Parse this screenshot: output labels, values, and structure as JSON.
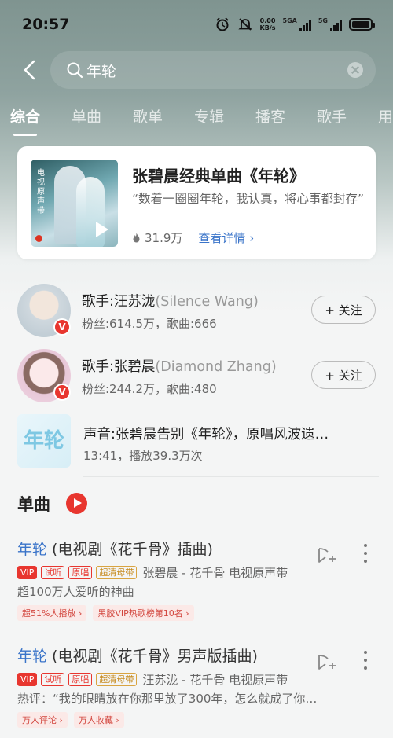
{
  "status_bar": {
    "time": "20:57",
    "net_speed_value": "0.00",
    "net_speed_unit": "KB/s",
    "signal1_label": "5GA",
    "signal2_label": "5G"
  },
  "search": {
    "query": "年轮"
  },
  "tabs": [
    "综合",
    "单曲",
    "歌单",
    "专辑",
    "播客",
    "歌手",
    "用"
  ],
  "feature_card": {
    "cover_text": "电视原声带",
    "title": "张碧晨经典单曲《年轮》",
    "description": "“数着一圈圈年轮，我认真，将心事都封存”",
    "plays": "31.9万",
    "detail_link": "查看详情"
  },
  "artists": [
    {
      "name": "歌手:汪苏泷",
      "alt_name": "(Silence Wang)",
      "meta": "粉丝:614.5万，歌曲:666",
      "follow_label": "+ 关注",
      "badge": "V"
    },
    {
      "name": "歌手:张碧晨",
      "alt_name": "(Diamond Zhang)",
      "meta": "粉丝:244.2万，歌曲:480",
      "follow_label": "+ 关注",
      "badge": "V"
    }
  ],
  "voice": {
    "thumb_text": "年轮",
    "title": "声音:张碧晨告别《年轮》，原唱风波遗…",
    "meta": "13:41，播放39.3万次"
  },
  "singles_section": {
    "title": "单曲"
  },
  "songs": [
    {
      "title_highlight": "年轮",
      "title_rest": " (电视剧《花千骨》插曲)",
      "tags": [
        "VIP",
        "试听",
        "原唱",
        "超清母带"
      ],
      "artist_line": "张碧晨 - 花千骨 电视原声带",
      "desc": "超100万人爱听的神曲",
      "chips": [
        "超51%人播放 ›",
        "黑胶VIP热歌榜第10名 ›"
      ]
    },
    {
      "title_highlight": "年轮",
      "title_rest": " (电视剧《花千骨》男声版插曲)",
      "tags": [
        "VIP",
        "试听",
        "原唱",
        "超清母带"
      ],
      "artist_line": "汪苏泷 - 花千骨 电视原声带",
      "desc": "热评：“我的眼睛放在你那里放了300年，怎么就成了你…",
      "chips": [
        "万人评论 ›",
        "万人收藏 ›"
      ]
    }
  ],
  "colors": {
    "accent_red": "#e8362f",
    "link_blue": "#3a74c9"
  }
}
